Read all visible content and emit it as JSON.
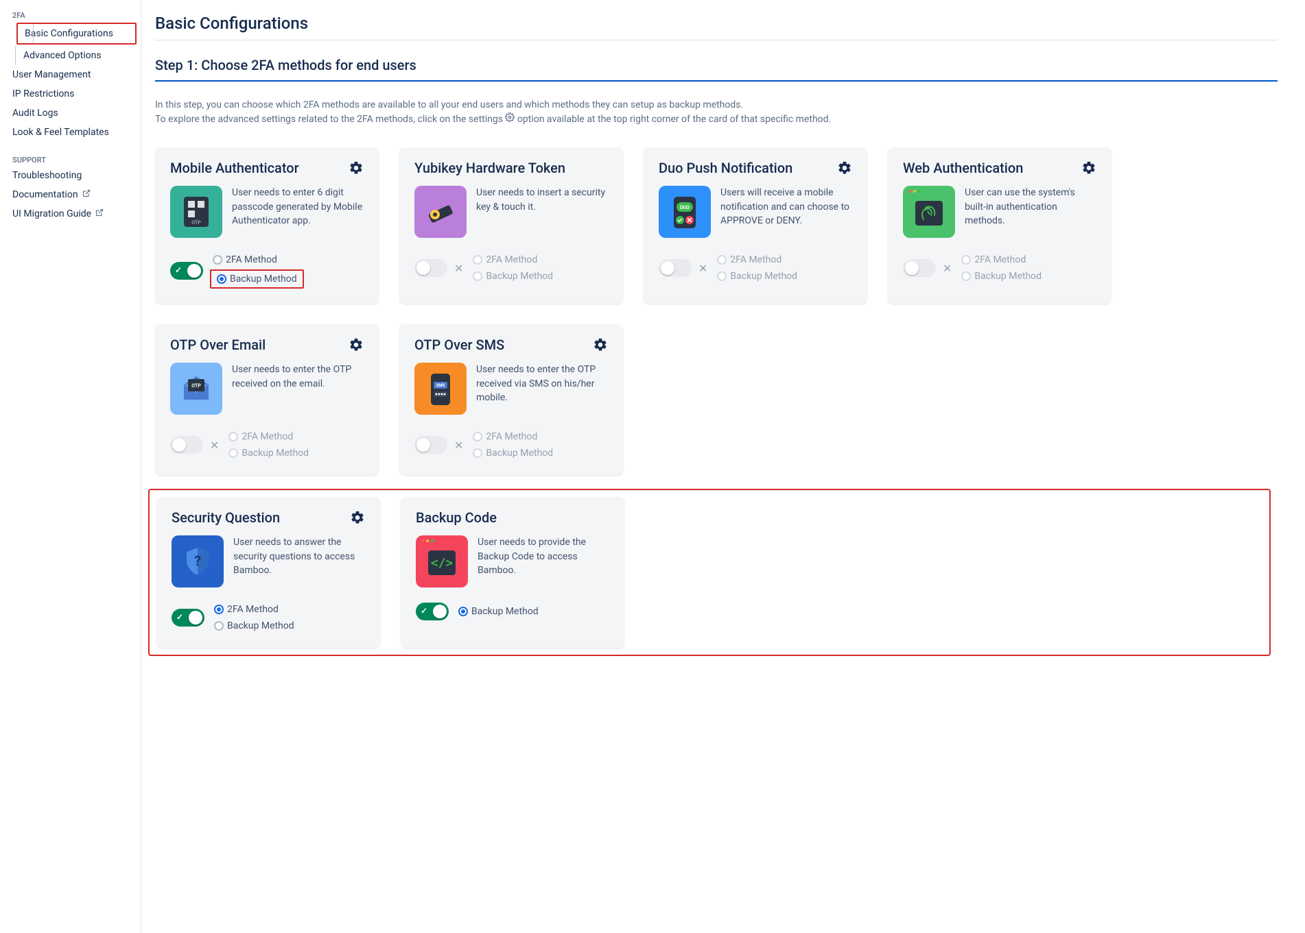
{
  "sidebar": {
    "section1_title": "2FA",
    "basic": "Basic Configurations",
    "advanced": "Advanced Options",
    "user_mgmt": "User Management",
    "ip": "IP Restrictions",
    "audit": "Audit Logs",
    "look": "Look & Feel Templates",
    "section2_title": "SUPPORT",
    "trouble": "Troubleshooting",
    "docs": "Documentation",
    "migration": "UI Migration Guide"
  },
  "page": {
    "title": "Basic Configurations",
    "step_title": "Step 1: Choose 2FA methods for end users",
    "desc_line1": "In this step, you can choose which 2FA methods are available to all your end users and which methods they can setup as backup methods.",
    "desc_line2_a": "To explore the advanced settings related to the 2FA methods, click on the settings ",
    "desc_line2_b": " option available at the top right corner of the card of that specific method."
  },
  "labels": {
    "twofa_method": "2FA Method",
    "backup_method": "Backup Method"
  },
  "cards": {
    "mobile_auth": {
      "title": "Mobile Authenticator",
      "desc": "User needs to enter 6 digit passcode generated by Mobile Authenticator app."
    },
    "yubikey": {
      "title": "Yubikey Hardware Token",
      "desc": "User needs to insert a security key & touch it."
    },
    "duo": {
      "title": "Duo Push Notification",
      "desc": "Users will receive a mobile notification and can choose to APPROVE or DENY."
    },
    "webauthn": {
      "title": "Web Authentication",
      "desc": "User can use the system's built-in authentication methods."
    },
    "otp_email": {
      "title": "OTP Over Email",
      "desc": "User needs to enter the OTP received on the email."
    },
    "otp_sms": {
      "title": "OTP Over SMS",
      "desc": "User needs to enter the OTP received via SMS on his/her mobile."
    },
    "sec_q": {
      "title": "Security Question",
      "desc": "User needs to answer the security questions to access Bamboo."
    },
    "backup_code": {
      "title": "Backup Code",
      "desc": "User needs to provide the Backup Code to access Bamboo."
    }
  }
}
